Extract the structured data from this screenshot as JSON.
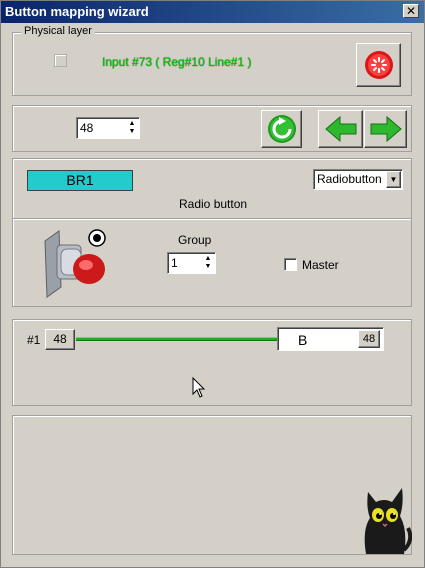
{
  "window": {
    "title": "Button mapping wizard",
    "close_label": "✕"
  },
  "physical": {
    "caption": "Physical layer",
    "input_info": "Input #73  ( Reg#10  Line#1 )",
    "input_color": "#00cc00"
  },
  "nav": {
    "spin_value": "48"
  },
  "button_def": {
    "name": "BR1",
    "name_color": "#22cccc",
    "type_selected": "Radiobutton",
    "type_caption": "Radio button",
    "group_label": "Group",
    "group_value": "1",
    "master_label": "Master"
  },
  "mapping": {
    "index_label": "#1",
    "left_value": "48",
    "key_label": "B",
    "right_value": "48",
    "line_color": "#22aa22"
  },
  "icons": {
    "reset": "red-stop-icon",
    "refresh": "green-refresh-icon",
    "prev": "green-left-arrow-icon",
    "next": "green-right-arrow-icon",
    "mascot": "black-cat-icon"
  }
}
